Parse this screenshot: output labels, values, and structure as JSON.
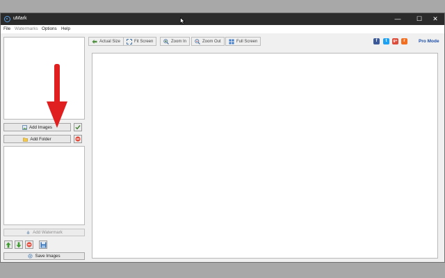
{
  "window": {
    "title": "uMark",
    "controls": {
      "minimize": "—",
      "maximize": "☐",
      "close": "✕"
    }
  },
  "menu": [
    {
      "label": "File",
      "disabled": false
    },
    {
      "label": "Watermarks",
      "disabled": true
    },
    {
      "label": "Options",
      "disabled": false
    },
    {
      "label": "Help",
      "disabled": false
    }
  ],
  "left_panel": {
    "add_images_label": "Add Images",
    "add_folder_label": "Add Folder",
    "add_watermark_label": "Add Watermark",
    "save_images_label": "Save Images"
  },
  "toolbar": {
    "actual_size_label": "Actual Size",
    "fit_screen_label": "Fit Screen",
    "zoom_in_label": "Zoom In",
    "zoom_out_label": "Zoom Out",
    "full_screen_label": "Full Screen",
    "pro_mode_label": "Pro Mode"
  },
  "social": {
    "facebook": "f",
    "twitter": "t",
    "google_plus": "g+",
    "rss": "r"
  },
  "colors": {
    "titlebar": "#2b2b2b",
    "annotation_arrow": "#e02020",
    "pro_mode": "#1d4fa8"
  }
}
